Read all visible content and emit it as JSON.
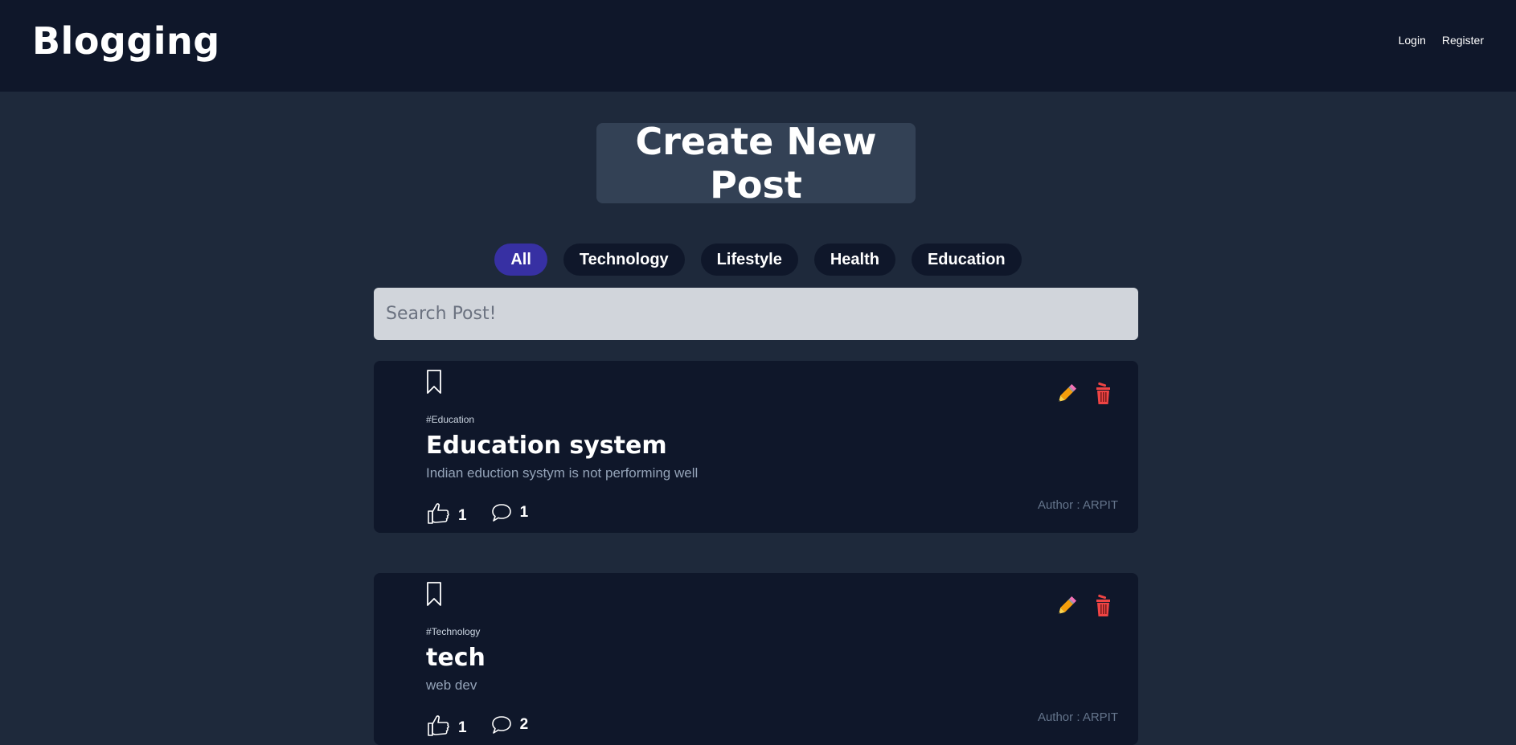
{
  "header": {
    "brand": "Blogging",
    "nav": [
      {
        "label": "Login"
      },
      {
        "label": "Register"
      }
    ]
  },
  "create_post": {
    "label": "Create New Post"
  },
  "categories": [
    {
      "label": "All",
      "active": true
    },
    {
      "label": "Technology",
      "active": false
    },
    {
      "label": "Lifestyle",
      "active": false
    },
    {
      "label": "Health",
      "active": false
    },
    {
      "label": "Education",
      "active": false
    }
  ],
  "search": {
    "placeholder": "Search Post!",
    "value": ""
  },
  "posts": [
    {
      "tag": "#Education",
      "title": "Education system",
      "description": "Indian eduction systym is not performing well",
      "likes": "1",
      "comments": "1",
      "author": "Author : ARPIT"
    },
    {
      "tag": "#Technology",
      "title": "tech",
      "description": "web dev",
      "likes": "1",
      "comments": "2",
      "author": "Author : ARPIT"
    }
  ],
  "icons": {
    "bookmark": "bookmark-icon",
    "edit": "pencil-icon",
    "delete": "trash-icon",
    "like": "thumbs-up-icon",
    "comment": "speech-bubble-icon"
  },
  "colors": {
    "page_bg": "#1e293b",
    "header_bg": "#0f172a",
    "card_bg": "#0f172a",
    "button_bg": "#334155",
    "active_category": "#3730a3",
    "search_bg": "#d1d5db"
  }
}
